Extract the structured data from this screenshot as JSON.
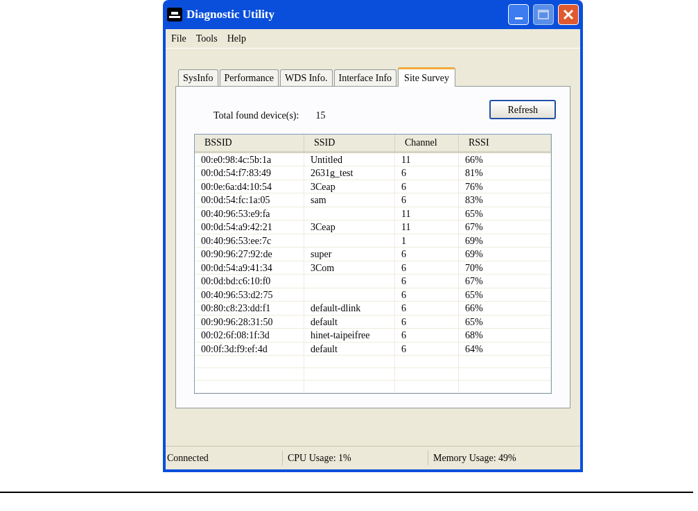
{
  "window": {
    "title": "Diagnostic Utility"
  },
  "menu": [
    "File",
    "Tools",
    "Help"
  ],
  "tabs": [
    {
      "label": "SysInfo",
      "selected": false
    },
    {
      "label": "Performance",
      "selected": false
    },
    {
      "label": "WDS Info.",
      "selected": false
    },
    {
      "label": "Interface Info",
      "selected": false
    },
    {
      "label": "Site Survey",
      "selected": true
    }
  ],
  "survey": {
    "total_label": "Total found device(s):",
    "total_value": "15",
    "refresh_button": "Refresh"
  },
  "table": {
    "columns": [
      "BSSID",
      "SSID",
      "Channel",
      "RSSI"
    ],
    "rows": [
      [
        "00:e0:98:4c:5b:1a",
        "Untitled",
        "11",
        "66%"
      ],
      [
        "00:0d:54:f7:83:49",
        "2631g_test",
        "6",
        "81%"
      ],
      [
        "00:0e:6a:d4:10:54",
        "3Ceap",
        "6",
        "76%"
      ],
      [
        "00:0d:54:fc:1a:05",
        "sam",
        "6",
        "83%"
      ],
      [
        "00:40:96:53:e9:fa",
        "",
        "11",
        "65%"
      ],
      [
        "00:0d:54:a9:42:21",
        "3Ceap",
        "11",
        "67%"
      ],
      [
        "00:40:96:53:ee:7c",
        "",
        "1",
        "69%"
      ],
      [
        "00:90:96:27:92:de",
        "super",
        "6",
        "69%"
      ],
      [
        "00:0d:54:a9:41:34",
        "3Com",
        "6",
        "70%"
      ],
      [
        "00:0d:bd:c6:10:f0",
        "",
        "6",
        "67%"
      ],
      [
        "00:40:96:53:d2:75",
        "",
        "6",
        "65%"
      ],
      [
        "00:80:c8:23:dd:f1",
        "default-dlink",
        "6",
        "66%"
      ],
      [
        "00:90:96:28:31:50",
        "default",
        "6",
        "65%"
      ],
      [
        "00:02:6f:08:1f:3d",
        "hinet-taipeifree",
        "6",
        "68%"
      ],
      [
        "00:0f:3d:f9:ef:4d",
        "default",
        "6",
        "64%"
      ]
    ]
  },
  "status_bar": [
    "Connected",
    "CPU Usage: 1%",
    "Memory Usage: 49%"
  ]
}
